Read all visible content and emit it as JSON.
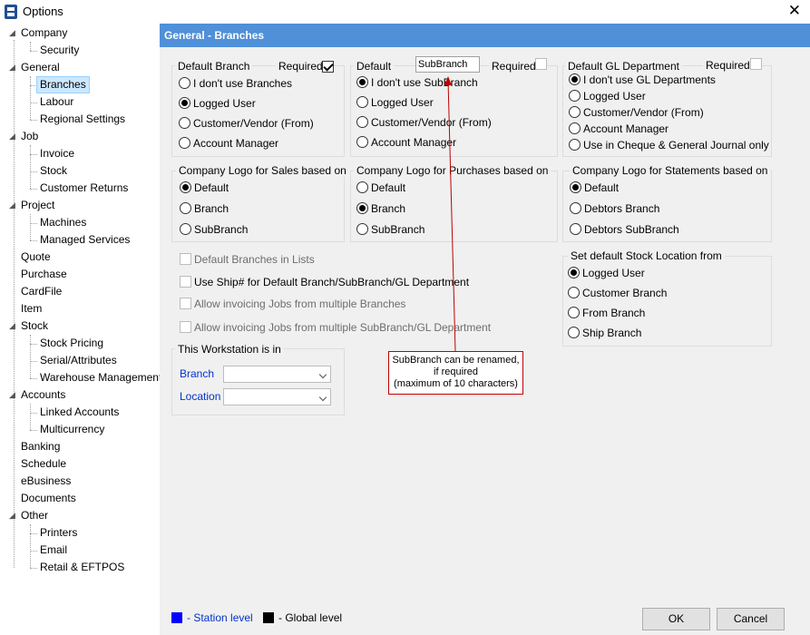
{
  "window": {
    "title": "Options",
    "close": "✕"
  },
  "tree": [
    {
      "label": "Company",
      "level": 0
    },
    {
      "label": "Security",
      "level": 1
    },
    {
      "label": "General",
      "level": 0
    },
    {
      "label": "Branches",
      "level": 1,
      "selected": true
    },
    {
      "label": "Labour",
      "level": 1
    },
    {
      "label": "Regional Settings",
      "level": 1
    },
    {
      "label": "Job",
      "level": 0
    },
    {
      "label": "Invoice",
      "level": 1
    },
    {
      "label": "Stock",
      "level": 1
    },
    {
      "label": "Customer Returns",
      "level": 1
    },
    {
      "label": "Project",
      "level": 0
    },
    {
      "label": "Machines",
      "level": 1
    },
    {
      "label": "Managed Services",
      "level": 1
    },
    {
      "label": "Quote",
      "level": 0
    },
    {
      "label": "Purchase",
      "level": 0
    },
    {
      "label": "CardFile",
      "level": 0
    },
    {
      "label": "Item",
      "level": 0
    },
    {
      "label": "Stock",
      "level": 0
    },
    {
      "label": "Stock Pricing",
      "level": 1
    },
    {
      "label": "Serial/Attributes",
      "level": 1
    },
    {
      "label": "Warehouse Management",
      "level": 1
    },
    {
      "label": "Accounts",
      "level": 0
    },
    {
      "label": "Linked Accounts",
      "level": 1
    },
    {
      "label": "Multicurrency",
      "level": 1
    },
    {
      "label": "Banking",
      "level": 0
    },
    {
      "label": "Schedule",
      "level": 0
    },
    {
      "label": "eBusiness",
      "level": 0
    },
    {
      "label": "Documents",
      "level": 0
    },
    {
      "label": "Other",
      "level": 0
    },
    {
      "label": "Printers",
      "level": 1
    },
    {
      "label": "Email",
      "level": 1
    },
    {
      "label": "Retail & EFTPOS",
      "level": 1
    }
  ],
  "header": {
    "title": "General - Branches"
  },
  "default_branch": {
    "label": "Default Branch",
    "required_label": "Required",
    "options": [
      "I don't use Branches",
      "Logged User",
      "Customer/Vendor (From)",
      "Account Manager"
    ]
  },
  "default_subbranch": {
    "label": "Default",
    "name_value": "SubBranch",
    "required_label": "Required",
    "options": [
      "I don't use SubBranch",
      "Logged User",
      "Customer/Vendor (From)",
      "Account Manager"
    ]
  },
  "default_gl": {
    "label": "Default GL Department",
    "required_label": "Required",
    "options": [
      "I don't use GL Departments",
      "Logged User",
      "Customer/Vendor (From)",
      "Account Manager",
      "Use in Cheque & General Journal only"
    ]
  },
  "logo_sales": {
    "label": "Company Logo for Sales based on",
    "options": [
      "Default",
      "Branch",
      "SubBranch"
    ]
  },
  "logo_purchases": {
    "label": "Company Logo for Purchases based on",
    "options": [
      "Default",
      "Branch",
      "SubBranch"
    ]
  },
  "logo_statements": {
    "label": "Company Logo for Statements based on",
    "options": [
      "Default",
      "Debtors Branch",
      "Debtors SubBranch"
    ]
  },
  "checkboxes": [
    "Default Branches in Lists",
    "Use Ship# for Default Branch/SubBranch/GL Department",
    "Allow invoicing Jobs from multiple Branches",
    "Allow invoicing Jobs from multiple SubBranch/GL Department"
  ],
  "workstation": {
    "label": "This Workstation is in",
    "branch_label": "Branch",
    "location_label": "Location"
  },
  "stock_location": {
    "label": "Set default Stock Location from",
    "options": [
      "Logged User",
      "Customer Branch",
      "From Branch",
      "Ship Branch"
    ]
  },
  "callout": {
    "line1": "SubBranch can be renamed,",
    "line2": "if required",
    "line3": "(maximum of 10 characters)"
  },
  "footer": {
    "station_level": "- Station level",
    "global_level": "- Global level",
    "ok": "OK",
    "cancel": "Cancel"
  },
  "colors": {
    "header_bg": "#4f90d8",
    "station": "#0000ff",
    "global": "#000000",
    "callout": "#c00000"
  }
}
